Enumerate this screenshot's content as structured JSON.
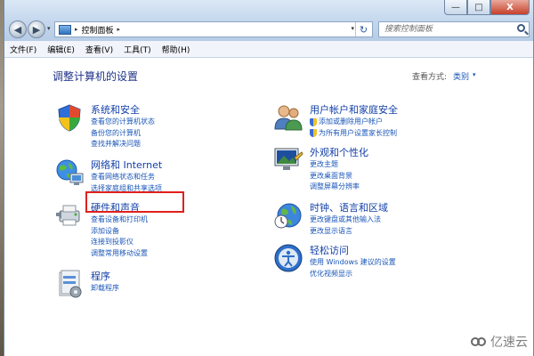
{
  "window": {
    "minimize": "—",
    "maximize": "□",
    "close": "X"
  },
  "nav": {
    "back_icon": "back-arrow-icon",
    "forward_icon": "forward-arrow-icon",
    "history_dropdown": "▾"
  },
  "address": {
    "arrow_before": "▸",
    "path": "控制面板",
    "arrow_after": "▸",
    "dropdown": "▾",
    "refresh": "↻"
  },
  "search": {
    "placeholder": "搜索控制面板"
  },
  "menu": [
    "文件(F)",
    "编辑(E)",
    "查看(V)",
    "工具(T)",
    "帮助(H)"
  ],
  "main": {
    "title": "调整计算机的设置",
    "view_by_label": "查看方式:",
    "view_by_value": "类别",
    "view_by_dropdown": "▾"
  },
  "categories": [
    {
      "title": "系统和安全",
      "icon": "system-security-icon",
      "links": [
        "查看您的计算机状态",
        "备份您的计算机",
        "查找并解决问题"
      ]
    },
    {
      "title": "网络和 Internet",
      "icon": "network-internet-icon",
      "links": [
        "查看网络状态和任务",
        "选择家庭组和共享选项"
      ]
    },
    {
      "title": "硬件和声音",
      "icon": "hardware-sound-icon",
      "links": [
        "查看设备和打印机",
        "添加设备",
        "连接到投影仪",
        "调整常用移动设置"
      ]
    },
    {
      "title": "程序",
      "icon": "programs-icon",
      "links": [
        "卸载程序"
      ]
    },
    {
      "title": "用户帐户和家庭安全",
      "icon": "user-accounts-icon",
      "links": [
        "添加或删除用户帐户",
        "为所有用户设置家长控制"
      ]
    },
    {
      "title": "外观和个性化",
      "icon": "appearance-icon",
      "links": [
        "更改主题",
        "更改桌面背景",
        "调整屏幕分辨率"
      ]
    },
    {
      "title": "时钟、语言和区域",
      "icon": "clock-region-icon",
      "links": [
        "更改键盘或其他输入法",
        "更改显示语言"
      ]
    },
    {
      "title": "轻松访问",
      "icon": "ease-of-access-icon",
      "links": [
        "使用 Windows 建议的设置",
        "优化视频显示"
      ]
    }
  ],
  "watermark": {
    "text": "亿速云"
  },
  "colors": {
    "link": "#1a56b8",
    "title": "#1340a8",
    "highlight": "#e0201c"
  }
}
